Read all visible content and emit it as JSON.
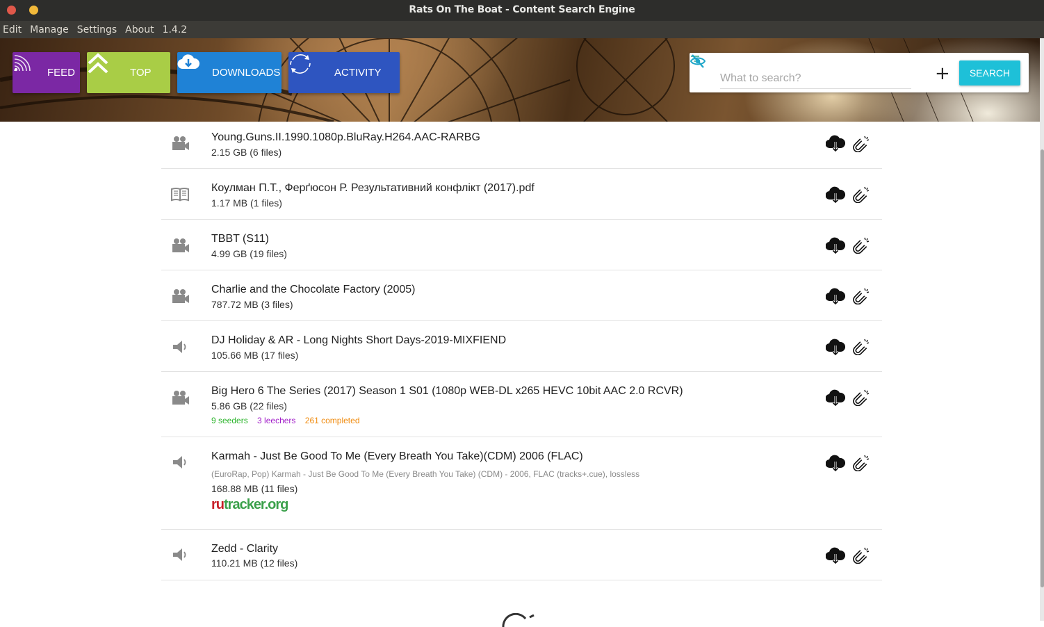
{
  "window": {
    "title": "Rats On The Boat - Content Search Engine"
  },
  "menu": [
    "Edit",
    "Manage",
    "Settings",
    "About",
    "1.4.2"
  ],
  "nav": {
    "feed": "FEED",
    "top": "TOP",
    "downloads": "DOWNLOADS",
    "activity": "ACTIVITY"
  },
  "search": {
    "placeholder": "What to search?",
    "button": "SEARCH"
  },
  "colors": {
    "feed": "#7b28a4",
    "top": "#a9cd46",
    "downloads": "#1f82d6",
    "activity": "#2e55c0",
    "search_button": "#1ec0d8",
    "seeders": "#2db52d",
    "leechers": "#a21fc9",
    "completed": "#f08a0c"
  },
  "results": [
    {
      "type": "video-icon",
      "title": "Young.Guns.II.1990.1080p.BluRay.H264.AAC-RARBG",
      "size": "2.15 GB (6 files)"
    },
    {
      "type": "book-icon",
      "title": "Коулман П.Т., Ферґюсон Р. Результативний конфлікт (2017).pdf",
      "size": "1.17 MB (1 files)"
    },
    {
      "type": "video-icon",
      "title": "TBBT (S11)",
      "size": "4.99 GB (19 files)"
    },
    {
      "type": "video-icon",
      "title": "Charlie and the Chocolate Factory (2005)",
      "size": "787.72 MB (3 files)"
    },
    {
      "type": "audio-icon",
      "title": "DJ Holiday & AR - Long Nights Short Days-2019-MIXFIEND",
      "size": "105.66 MB (17 files)"
    },
    {
      "type": "video-icon",
      "title": "Big Hero 6 The Series (2017) Season 1 S01 (1080p WEB-DL x265 HEVC 10bit AAC 2.0 RCVR)",
      "size": "5.86 GB (22 files)",
      "seeders": "9 seeders",
      "leechers": "3 leechers",
      "completed": "261 completed"
    },
    {
      "type": "audio-icon",
      "title": "Karmah - Just Be Good To Me (Every Breath You Take)(CDM) 2006 (FLAC)",
      "description": "(EuroRap, Pop) Karmah - Just Be Good To Me (Every Breath You Take) (CDM) - 2006, FLAC (tracks+.cue), lossless",
      "size": "168.88 MB (11 files)",
      "tracker_a": "ru",
      "tracker_b": "tracker",
      "tracker_c": ".org"
    },
    {
      "type": "audio-icon",
      "title": "Zedd - Clarity",
      "size": "110.21 MB (12 files)"
    }
  ]
}
